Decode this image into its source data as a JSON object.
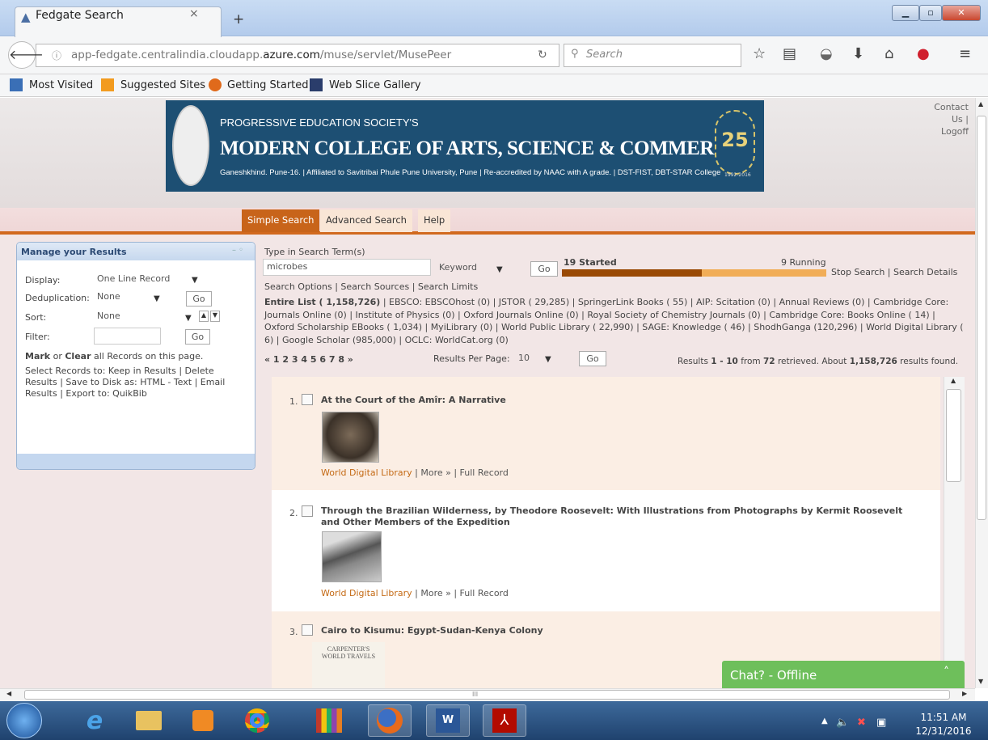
{
  "browser": {
    "tab_title": "Fedgate Search",
    "tab_close": "×",
    "new_tab": "+",
    "url_gray": "app-fedgate.centralindia.cloudapp.",
    "url_dark": "azure.com",
    "url_rest": "/muse/servlet/MusePeer",
    "search_placeholder": "Search",
    "bookmarks": [
      "Most Visited",
      "Suggested Sites",
      "Getting Started",
      "Web Slice Gallery"
    ]
  },
  "banner": {
    "society": "PROGRESSIVE EDUCATION SOCIETY'S",
    "college": "MODERN COLLEGE OF ARTS, SCIENCE & COMMERCE",
    "tagline": "Ganeshkhind. Pune-16.  |  Affiliated to Savitribai Phule Pune University, Pune  |  Re-accredited by NAAC with A grade.  |  DST-FIST, DBT-STAR College",
    "jubilee_number": "25",
    "jubilee_years": "1992-2016"
  },
  "top_links": [
    "Contact",
    "Us |",
    "Logoff"
  ],
  "nav_tabs": [
    "Simple Search",
    "Advanced Search",
    "Help"
  ],
  "panel": {
    "title": "Manage your Results",
    "display_label": "Display:",
    "display_value": "One Line Record",
    "dedup_label": "Deduplication:",
    "dedup_value": "None",
    "sort_label": "Sort:",
    "sort_value": "None",
    "filter_label": "Filter:",
    "go": "Go",
    "mark": "Mark",
    "or": " or ",
    "clear": "Clear",
    "mark_rest": " all Records on this page.",
    "select_text": "Select Records to: Keep in Results | Delete Results | Save to Disk as: HTML - Text | Email Results | Export to: QuikBib"
  },
  "search": {
    "label": "Type in Search Term(s)",
    "term": "microbes",
    "type": "Keyword",
    "go": "Go",
    "started": "19 Started",
    "running": "9 Running",
    "progress_fraction": 0.53,
    "stop": "Stop Search | Search Details",
    "options": "Search Options | Search Sources | Search Limits",
    "sources_bold": "Entire List ( 1,158,726)",
    "sources_rest": " | EBSCO: EBSCOhost (0) | JSTOR ( 29,285) | SpringerLink Books ( 55) | AIP: Scitation (0) | Annual Reviews (0) | Cambridge Core: Journals Online (0) | Institute of Physics (0) | Oxford Journals Online (0) | Royal Society of Chemistry Journals (0) | Cambridge Core: Books Online ( 14) | Oxford Scholarship EBooks ( 1,034) | MyiLibrary (0) | World Public Library ( 22,990) | SAGE: Knowledge ( 46) | ShodhGanga (120,296) | World Digital Library ( 6) | Google Scholar (985,000) | OCLC: WorldCat.org (0)",
    "pager": "« 1 2 3 4 5 6 7 8 »",
    "per_page_label": "Results Per Page:",
    "per_page_value": "10",
    "summary_pre": "Results ",
    "summary_range": "1 - 10",
    "summary_mid": " from ",
    "summary_count": "72",
    "summary_mid2": " retrieved. About ",
    "summary_total": "1,158,726",
    "summary_post": " results found."
  },
  "results": [
    {
      "num": "1.",
      "title": "At the Court of the Amîr: A Narrative",
      "source": "World Digital Library",
      "links": " | More » | Full Record"
    },
    {
      "num": "2.",
      "title": "Through the Brazilian Wilderness, by Theodore Roosevelt: With Illustrations from Photographs by Kermit Roosevelt and Other Members of the Expedition",
      "source": "World Digital Library",
      "links": " | More » | Full Record"
    },
    {
      "num": "3.",
      "title": "Cairo to Kisumu: Egypt-Sudan-Kenya Colony",
      "thumb_text": "CARPENTER'S WORLD TRAVELS"
    }
  ],
  "chat": "Chat? - Offline",
  "scroll_label": "III",
  "clock": {
    "time": "11:51 AM",
    "date": "12/31/2016"
  }
}
